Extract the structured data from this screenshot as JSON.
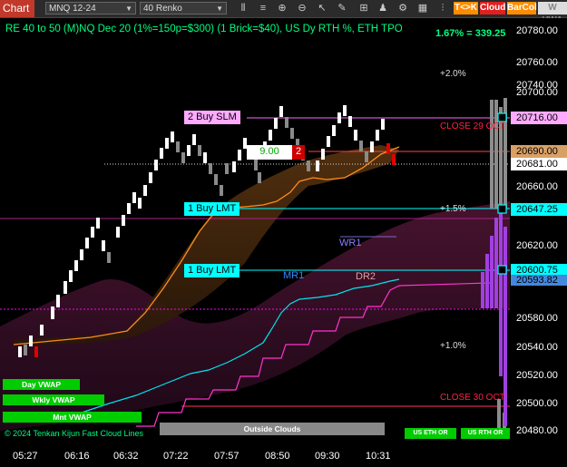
{
  "toolbar": {
    "title": "Chart",
    "instrument": "MNQ 12-24",
    "bartype": "40 Renko",
    "icons": [
      "bars-icon",
      "zoom-in-icon",
      "zoom-out-icon",
      "cursor-icon",
      "drawing-icon",
      "properties-icon",
      "strategy-icon",
      "settings-icon",
      "data-box-icon"
    ],
    "btn_tk": "T<>K",
    "btn_cloud": "Cloud",
    "btn_barcol": "BarCol",
    "btn_vwap": "W VWA"
  },
  "header": {
    "text": "RE 40 to 50 (M)NQ Dec 20 (1%=150p=$300) (1 Brick=$40), US Dy RTH %, ETH TPO",
    "pct": "1.67% = 339.25"
  },
  "colors": {
    "up": "#ffffff",
    "down": "#888888",
    "red": "#e00000",
    "cyan": "#00ffff",
    "magenta": "#ff66ff",
    "orange": "#ff8c1a",
    "green": "#00cc00"
  },
  "yaxis": [
    "20780.00",
    "20760.00",
    "20740.00",
    "20700.00",
    "20660.00",
    "20620.00",
    "20580.00",
    "20540.00",
    "20520.00",
    "20500.00",
    "20480.00"
  ],
  "price_labels": {
    "slm": "20716.00",
    "current": "20690.00",
    "last": "20681.00",
    "lmt1": "20647.25",
    "lmt2": "20600.75",
    "other": "20593.82"
  },
  "xaxis": [
    "05:27",
    "06:16",
    "06:32",
    "07:22",
    "07:57",
    "08:50",
    "09:30",
    "10:31"
  ],
  "orders": {
    "slm": "2 Buy SLM",
    "lmt1": "1 Buy LMT",
    "lmt2": "1 Buy LMT",
    "price_box": "9.00",
    "qty_box": "2"
  },
  "annotations": {
    "p2": "+2.0%",
    "p15": "+1.5%",
    "p1": "+1.0%",
    "close29": "CLOSE 29 OCT",
    "close30": "CLOSE 30 OCT",
    "wr1": "WR1",
    "mr1": "MR1",
    "dr2": "DR2"
  },
  "vwap_buttons": {
    "day": "Day VWAP",
    "wkly": "Wkly VWAP",
    "mnt": "Mnt VWAP"
  },
  "bottom": {
    "copyright": "© 2024 Tenkan Kijun Fast Cloud Lines",
    "outside": "Outside Clouds",
    "us_eth_or_1": "US ETH OR",
    "us_eth_or_2": "US RTH OR"
  }
}
